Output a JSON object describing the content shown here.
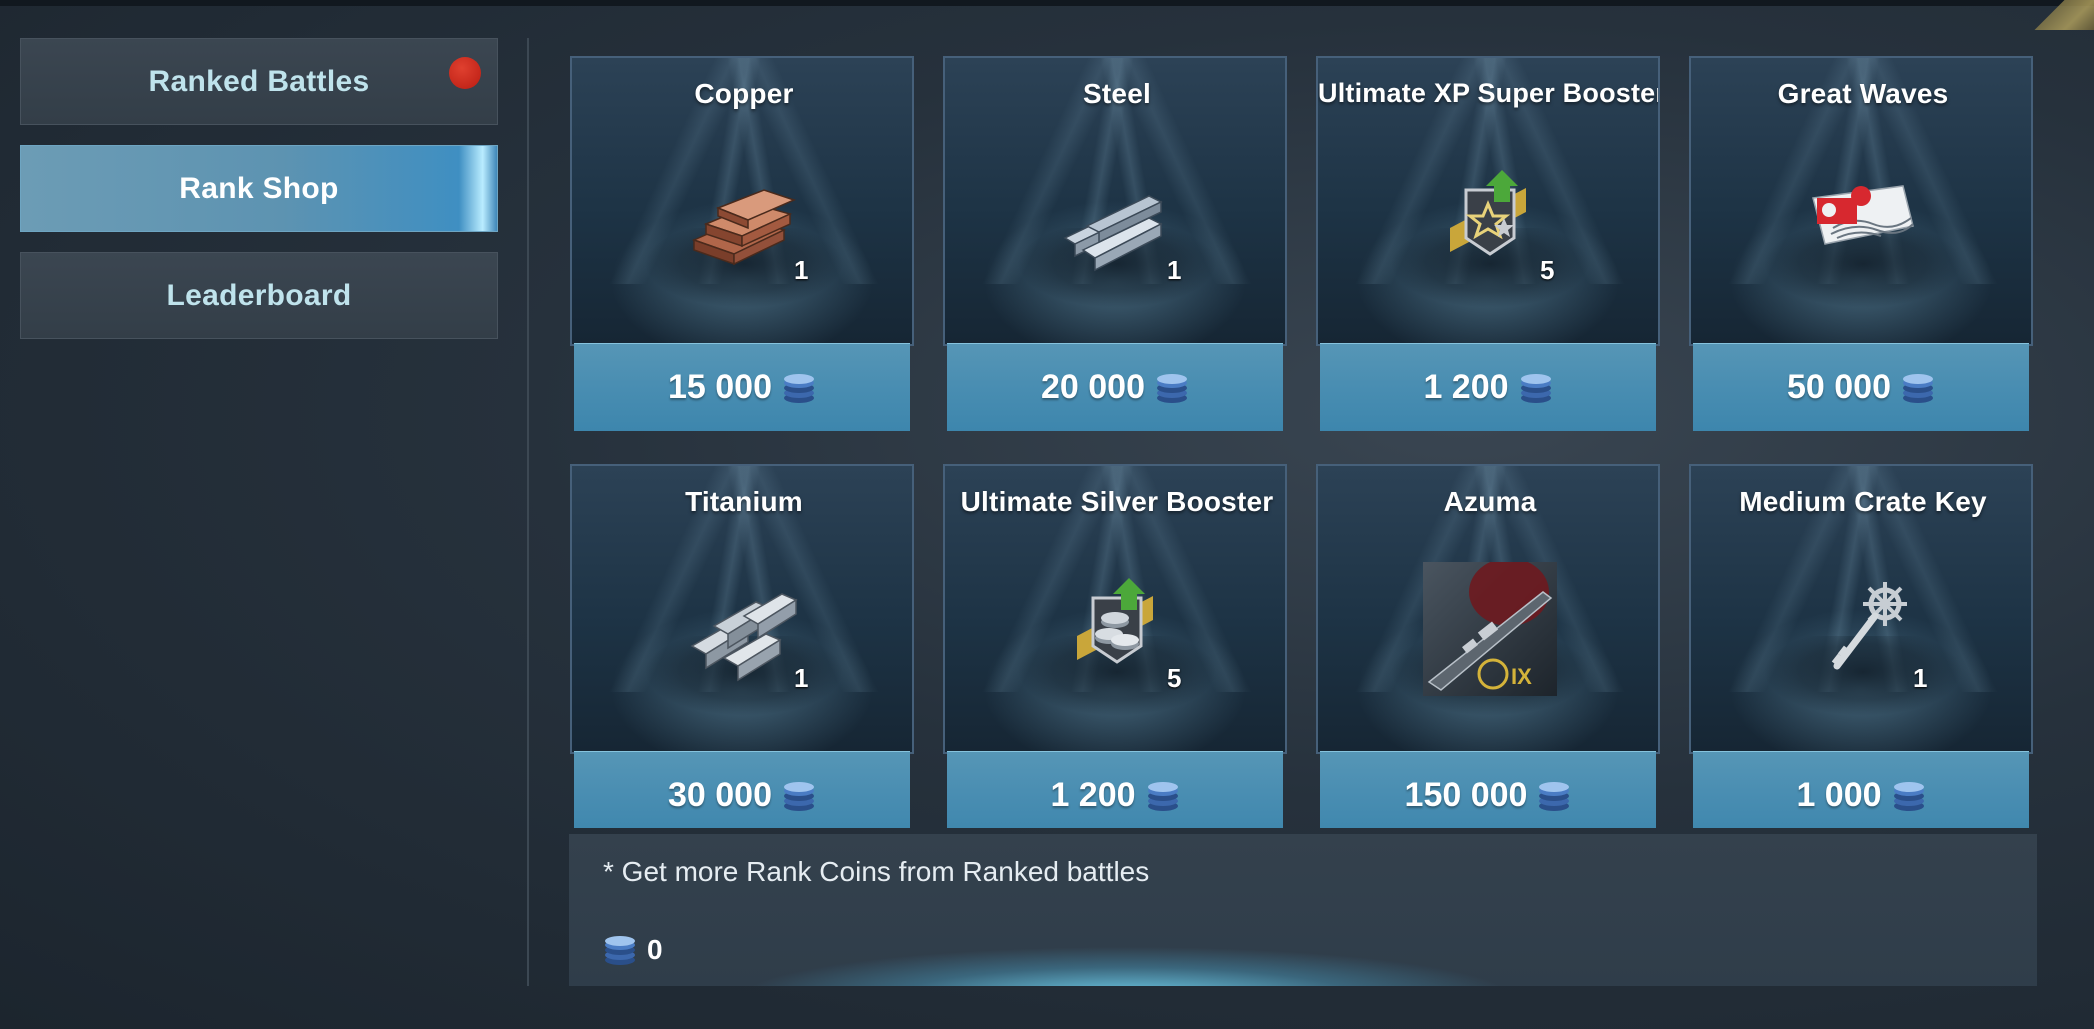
{
  "sidebar": {
    "items": [
      {
        "label": "Ranked Battles",
        "notification": true
      },
      {
        "label": "Rank Shop",
        "active": true
      },
      {
        "label": "Leaderboard"
      }
    ]
  },
  "shop": {
    "currency_icon": "rank-coin-icon",
    "items": [
      {
        "title": "Copper",
        "quantity": "1",
        "price": "15 000",
        "icon": "copper-ingots-icon"
      },
      {
        "title": "Steel",
        "quantity": "1",
        "price": "20 000",
        "icon": "steel-beams-icon"
      },
      {
        "title": "Ultimate XP Super Booster",
        "quantity": "5",
        "price": "1 200",
        "icon": "xp-booster-icon"
      },
      {
        "title": "Great Waves",
        "quantity": "",
        "price": "50 000",
        "icon": "great-waves-flag-icon"
      },
      {
        "title": "Titanium",
        "quantity": "1",
        "price": "30 000",
        "icon": "titanium-bars-icon"
      },
      {
        "title": "Ultimate Silver Booster",
        "quantity": "5",
        "price": "1 200",
        "icon": "silver-booster-icon"
      },
      {
        "title": "Azuma",
        "quantity": "",
        "tier": "IX",
        "price": "150 000",
        "icon": "ship-azuma-icon"
      },
      {
        "title": "Medium Crate Key",
        "quantity": "1",
        "price": "1 000",
        "icon": "crate-key-icon"
      }
    ]
  },
  "footer": {
    "note": "* Get more Rank Coins from Ranked battles",
    "balance": "0"
  }
}
